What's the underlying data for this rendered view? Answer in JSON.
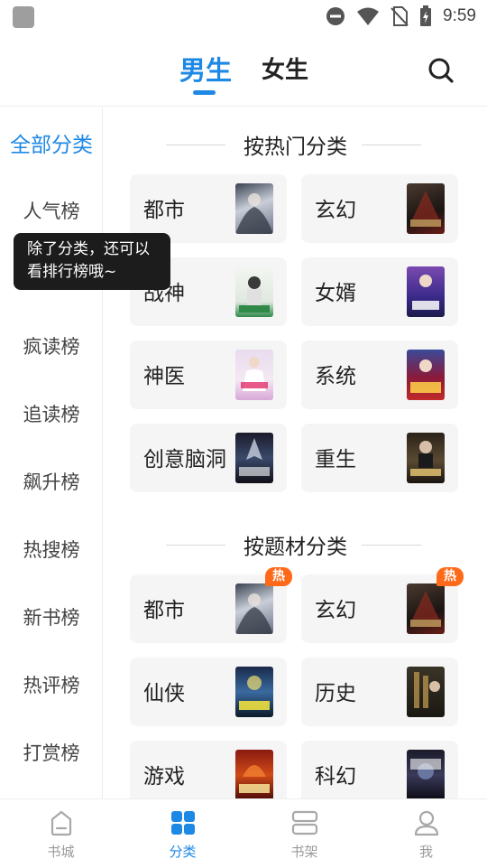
{
  "status_bar": {
    "time": "9:59",
    "icons": [
      "app-icon",
      "dnd-icon",
      "wifi-icon",
      "no-sim-icon",
      "battery-charging-icon"
    ]
  },
  "header": {
    "tabs": [
      {
        "label": "男生",
        "active": true
      },
      {
        "label": "女生",
        "active": false
      }
    ],
    "search_icon": "search-icon"
  },
  "sidebar": {
    "items": [
      {
        "label": "全部分类",
        "active": true
      },
      {
        "label": "人气榜"
      },
      {
        "label": ""
      },
      {
        "label": "疯读榜"
      },
      {
        "label": "追读榜"
      },
      {
        "label": "飙升榜"
      },
      {
        "label": "热搜榜"
      },
      {
        "label": "新书榜"
      },
      {
        "label": "热评榜"
      },
      {
        "label": "打赏榜"
      }
    ],
    "tooltip_lines": [
      "除了分类，还可以",
      "看排行榜哦~"
    ]
  },
  "sections": [
    {
      "title": "按热门分类",
      "cards": [
        {
          "label": "都市",
          "cover": "战神龙婿",
          "hot": false
        },
        {
          "label": "玄幻",
          "cover": "仙武帝尊",
          "hot": false
        },
        {
          "label": "战神",
          "cover": "傲天医神",
          "hot": false
        },
        {
          "label": "女婿",
          "cover": "上门女婿",
          "hot": false
        },
        {
          "label": "神医",
          "cover": "绝品神医",
          "hot": false
        },
        {
          "label": "系统",
          "cover": "1000倍返还",
          "hot": false
        },
        {
          "label": "创意脑洞",
          "cover": "元尊",
          "hot": false
        },
        {
          "label": "重生",
          "cover": "镇国神婿",
          "hot": false
        }
      ]
    },
    {
      "title": "按题材分类",
      "cards": [
        {
          "label": "都市",
          "cover": "战神龙婿",
          "hot": true,
          "badge": "热"
        },
        {
          "label": "玄幻",
          "cover": "仙武帝尊",
          "hot": true,
          "badge": "热"
        },
        {
          "label": "仙侠",
          "cover": "七界传说",
          "hot": false
        },
        {
          "label": "历史",
          "cover": "赘婿",
          "hot": false
        },
        {
          "label": "游戏",
          "cover": "进化升级",
          "hot": false
        },
        {
          "label": "科幻",
          "cover": "末世",
          "hot": false
        }
      ]
    }
  ],
  "bottom_nav": [
    {
      "label": "书城",
      "icon": "bookstore-icon",
      "active": false
    },
    {
      "label": "分类",
      "icon": "category-grid-icon",
      "active": true
    },
    {
      "label": "书架",
      "icon": "bookshelf-icon",
      "active": false
    },
    {
      "label": "我",
      "icon": "profile-icon",
      "active": false
    }
  ],
  "colors": {
    "accent": "#1e88e5",
    "hot_badge": "#ff6a1a",
    "tooltip_bg": "#1c1c1c",
    "card_bg": "#f5f5f5"
  }
}
